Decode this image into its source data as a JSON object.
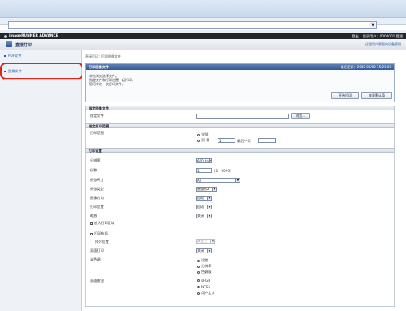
{
  "browser": {
    "address_value": "",
    "dropdown_arrow": "▼"
  },
  "topbar": {
    "brand": "imageRUNNER ADVANCE",
    "login": "登出",
    "user_label": "登录用户：0000001 管理"
  },
  "app": {
    "title": "直接打印",
    "top_link": "远程用户界面的设备管理"
  },
  "sidebar": {
    "items": [
      {
        "label": "PDF文件"
      },
      {
        "label": "图像文件"
      }
    ]
  },
  "breadcrumb": "直接打印：打印图像文件",
  "panel": {
    "title": "打印图像文件",
    "updated": "最后更新：2000 00/00 15:21:00",
    "lines": [
      "单击浏览选择文件。",
      "指定文件和打印设置一起打印。",
      "您可单次一次打印文件。"
    ],
    "start_button": "开始打印",
    "reset_button": "恢复默认值"
  },
  "sections": {
    "specify_file": "指定图像文件",
    "print_range": "指定打印范围",
    "print_settings": "打印设置"
  },
  "file": {
    "label": "指定文件",
    "value": "",
    "browse": "浏览..."
  },
  "range": {
    "label": "打印范围",
    "all": "全部",
    "pages": "页",
    "from_label": "第",
    "from_value": "1",
    "to_label": "最后一页",
    "to_value": ""
  },
  "settings": {
    "resolution": {
      "label": "分辨率",
      "value": "600 dpi"
    },
    "copies": {
      "label": "份数",
      "value": "1",
      "hint": "(1 - 9999)"
    },
    "paper_size": {
      "label": "纸张尺寸",
      "value": "A4"
    },
    "paper_type": {
      "label": "纸张类型",
      "value": "普通纸2"
    },
    "orientation": {
      "label": "图像方向",
      "value": "自动"
    },
    "print_position": {
      "label": "打印位置",
      "value": "自动"
    },
    "zoom": {
      "label": "缩放",
      "value": "关闭"
    },
    "enlarge_print_area": "放大打印区域",
    "n_on_1": "打印布局",
    "order_label": "排列位置",
    "order_value": "从左上",
    "duplex": {
      "label": "双面打印",
      "value": "关闭"
    },
    "halftone": {
      "label": "半色调",
      "options": [
        {
          "label": "误差",
          "on": false
        },
        {
          "label": "分辨率",
          "on": true
        },
        {
          "label": "色调级",
          "on": false
        }
      ]
    },
    "color_mode": {
      "label": "双面按钮",
      "options": [
        {
          "label": "sRGB",
          "on": false
        },
        {
          "label": "NTSC",
          "on": true
        },
        {
          "label": "用户定义",
          "on": false
        }
      ]
    }
  }
}
